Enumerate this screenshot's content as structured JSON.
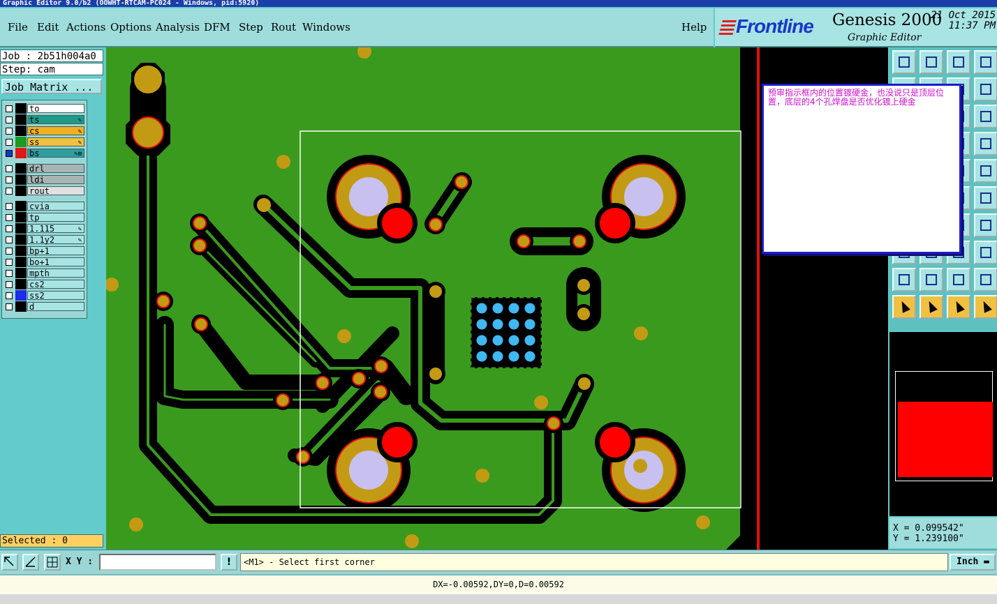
{
  "window": {
    "title": "Graphic Editor 9.0/b2 (OOWHT-RTCAM-PC024 - Windows, pid:5920)"
  },
  "menu": [
    "File",
    "Edit",
    "Actions",
    "Options",
    "Analysis",
    "DFM",
    "Step",
    "Rout",
    "Windows"
  ],
  "help": "Help",
  "brand": {
    "logo": "Frontline",
    "product": "Genesis 2000",
    "subtitle": "Graphic Editor",
    "date": "21 Oct 2015",
    "time": "11:37 PM"
  },
  "job": {
    "job_line": "Job : 2b51h004a0",
    "step_line": "Step: cam",
    "matrix_button": "Job Matrix ..."
  },
  "layers": [
    {
      "name": "to",
      "color": "#ffffff",
      "swatch": "#000000",
      "edit": ""
    },
    {
      "name": "ts",
      "color": "#1f9a88",
      "swatch": "#000000",
      "edit": "✎"
    },
    {
      "name": "cs",
      "color": "#f0b020",
      "swatch": "#000000",
      "edit": "✎"
    },
    {
      "name": "ss",
      "color": "#f0c040",
      "swatch": "#1c9c1c",
      "edit": "✎"
    },
    {
      "name": "bs",
      "color": "#2e9e9e",
      "swatch": "#e01818",
      "edit": "✎⊞",
      "active": true
    },
    {
      "name": "drl",
      "color": "#a8b4b4",
      "swatch": "#000000",
      "edit": ""
    },
    {
      "name": "ldi",
      "color": "#a8b4b4",
      "swatch": "#000000",
      "edit": ""
    },
    {
      "name": "rout",
      "color": "#e0e0e0",
      "swatch": "#000000",
      "edit": ""
    },
    {
      "name": "cvia",
      "color": "#a8e4e4",
      "swatch": "#000000",
      "edit": ""
    },
    {
      "name": "tp",
      "color": "#a8e4e4",
      "swatch": "#000000",
      "edit": ""
    },
    {
      "name": "1.115",
      "color": "#a8e4e4",
      "swatch": "#000000",
      "edit": "✎"
    },
    {
      "name": "1.1y2",
      "color": "#a8e4e4",
      "swatch": "#000000",
      "edit": "✎"
    },
    {
      "name": "bp+1",
      "color": "#a8e4e4",
      "swatch": "#000000",
      "edit": ""
    },
    {
      "name": "bo+1",
      "color": "#a8e4e4",
      "swatch": "#000000",
      "edit": ""
    },
    {
      "name": "mpth",
      "color": "#a8e4e4",
      "swatch": "#000000",
      "edit": ""
    },
    {
      "name": "cs2",
      "color": "#a8e4e4",
      "swatch": "#000000",
      "edit": ""
    },
    {
      "name": "ss2",
      "color": "#a8e4e4",
      "swatch": "#1c2ce8",
      "edit": ""
    },
    {
      "name": "d",
      "color": "#a8e4e4",
      "swatch": "#000000",
      "edit": ""
    }
  ],
  "selected": "Selected : 0",
  "note": "预审指示框内的位置镀硬金，也没说只是顶层位置，底层的4个孔焊盘是否优化镀上硬金",
  "coords": {
    "x": "X = 0.099542\"",
    "y": "Y = 1.239100\""
  },
  "cmd": {
    "xy_label": "X Y :",
    "xy_value": "",
    "bang": "!",
    "prompt": "<M1> - Select first corner",
    "units": "Inch"
  },
  "delta": "DX=-0.00592,DY=0,D=0.00592",
  "colors": {
    "board": "#3a9a1e",
    "trace": "#000000",
    "pad": "#c39a14",
    "padring": "#e01010",
    "drill": "#c8c0ee",
    "via": "#ff0000",
    "bga": "#40b8f0"
  }
}
